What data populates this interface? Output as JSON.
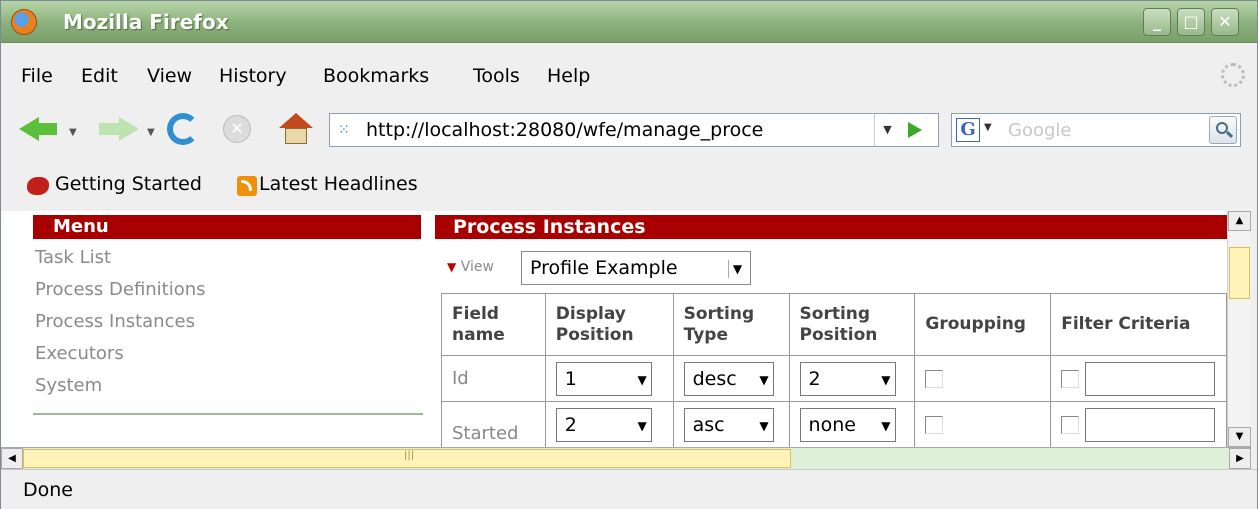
{
  "window": {
    "title": "Mozilla Firefox"
  },
  "menubar": {
    "items": [
      {
        "label": "File"
      },
      {
        "label": "Edit"
      },
      {
        "label": "View"
      },
      {
        "label": "History"
      },
      {
        "label": "Bookmarks"
      },
      {
        "label": "Tools"
      },
      {
        "label": "Help"
      }
    ]
  },
  "navigation": {
    "url": "http://localhost:28080/wfe/manage_proce",
    "search_placeholder": "Google"
  },
  "bookmarks": [
    {
      "label": "Getting Started"
    },
    {
      "label": "Latest Headlines"
    }
  ],
  "sidebar": {
    "header": "Menu",
    "items": [
      {
        "label": "Task List"
      },
      {
        "label": "Process Definitions"
      },
      {
        "label": "Process Instances"
      },
      {
        "label": "Executors"
      },
      {
        "label": "System"
      }
    ]
  },
  "main": {
    "header": "Process Instances",
    "view_label": "View",
    "view_value": "Profile Example",
    "table": {
      "columns": [
        "Field name",
        "Display Position",
        "Sorting Type",
        "Sorting Position",
        "Groupping",
        "Filter Criteria"
      ],
      "rows": [
        {
          "field": "Id",
          "display_position": "1",
          "sorting_type": "desc",
          "sorting_position": "2"
        },
        {
          "field": "Started",
          "display_position": "2",
          "sorting_type": "asc",
          "sorting_position": "none"
        }
      ]
    }
  },
  "status": {
    "text": "Done"
  },
  "colors": {
    "header_bg": "#a80000",
    "titlebar": "#8bb07b"
  }
}
